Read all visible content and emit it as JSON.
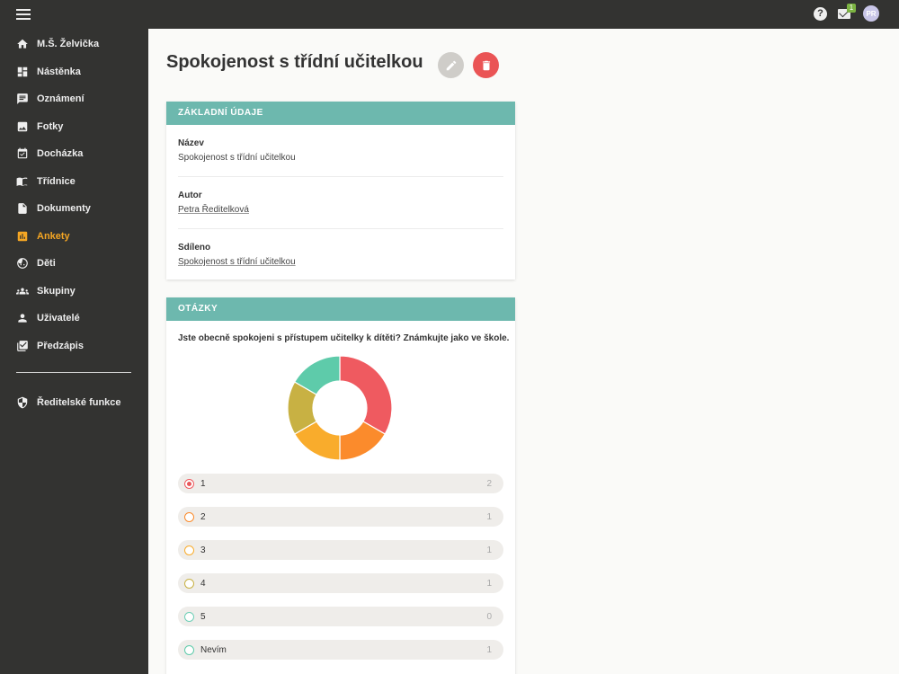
{
  "topbar": {
    "help": "?",
    "mail_badge": "1",
    "avatar_initials": "PR"
  },
  "sidebar": {
    "items": [
      {
        "label": "M.Š. Želvička",
        "icon": "home-icon"
      },
      {
        "label": "Nástěnka",
        "icon": "dashboard-icon"
      },
      {
        "label": "Oznámení",
        "icon": "message-icon"
      },
      {
        "label": "Fotky",
        "icon": "photo-icon"
      },
      {
        "label": "Docházka",
        "icon": "calendar-check-icon"
      },
      {
        "label": "Třídnice",
        "icon": "book-icon"
      },
      {
        "label": "Dokumenty",
        "icon": "document-icon"
      },
      {
        "label": "Ankety",
        "icon": "poll-icon",
        "active": true
      },
      {
        "label": "Děti",
        "icon": "child-face-icon"
      },
      {
        "label": "Skupiny",
        "icon": "group-icon"
      },
      {
        "label": "Uživatelé",
        "icon": "person-icon"
      },
      {
        "label": "Předzápis",
        "icon": "checklist-icon"
      }
    ],
    "admin_item": {
      "label": "Ředitelské funkce",
      "icon": "admin-shield-icon"
    }
  },
  "page": {
    "title": "Spokojenost s třídní učitelkou"
  },
  "basic_info": {
    "header": "ZÁKLADNÍ ÚDAJE",
    "name_label": "Název",
    "name_value": "Spokojenost s třídní učitelkou",
    "author_label": "Autor",
    "author_value": "Petra Ředitelková",
    "shared_label": "Sdíleno",
    "shared_value": "Spokojenost s třídní učitelkou"
  },
  "questions": {
    "header": "OTÁZKY",
    "question_text": "Jste obecně spokojeni s přístupem učitelky k dítěti? Známkujte jako ve škole.",
    "options": [
      {
        "label": "1",
        "count": "2",
        "selected": true
      },
      {
        "label": "2",
        "count": "1",
        "selected": false
      },
      {
        "label": "3",
        "count": "1",
        "selected": false
      },
      {
        "label": "4",
        "count": "1",
        "selected": false
      },
      {
        "label": "5",
        "count": "0",
        "selected": false
      },
      {
        "label": "Nevím",
        "count": "1",
        "selected": false
      }
    ]
  },
  "chart_data": {
    "type": "pie",
    "categories": [
      "1",
      "2",
      "3",
      "4",
      "5",
      "Nevím"
    ],
    "values": [
      2,
      1,
      1,
      1,
      0,
      1
    ],
    "colors": [
      "#ef5a60",
      "#fb8b2c",
      "#f9ac2c",
      "#c8b143",
      "#6ecfb6",
      "#5ecbaa"
    ]
  }
}
